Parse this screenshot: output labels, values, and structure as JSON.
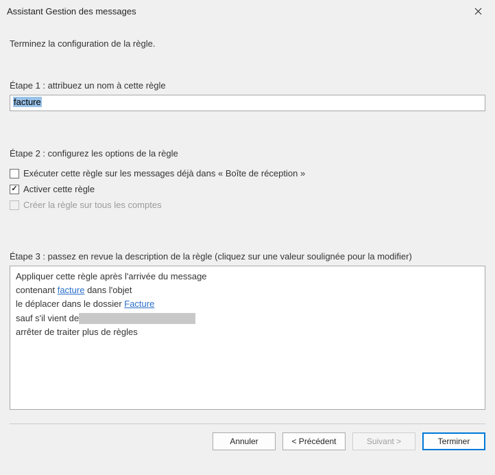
{
  "titlebar": {
    "title": "Assistant Gestion des messages",
    "close_label": "✕"
  },
  "intro": "Terminez la configuration de la règle.",
  "step1": {
    "label": "Étape 1 : attribuez un nom à cette règle",
    "value": "facture"
  },
  "step2": {
    "label": "Étape 2 : configurez les options de la règle",
    "opt_run_now": "Exécuter cette règle sur les messages déjà dans « Boîte de réception »",
    "opt_activate": "Activer cette règle",
    "opt_all_accounts": "Créer la règle sur tous les comptes"
  },
  "step3": {
    "label": "Étape 3 : passez en revue la description de la règle (cliquez sur une valeur soulignée pour la modifier)",
    "line_apply": "Appliquer cette règle après l'arrivée du message",
    "line_containing_pre": "contenant ",
    "line_containing_link": "facture",
    "line_containing_post": " dans l'objet",
    "line_move_pre": "le déplacer dans le dossier ",
    "line_move_link": "Facture",
    "line_except_pre": "sauf s'il vient de",
    "line_stop": "arrêter de traiter plus de règles"
  },
  "buttons": {
    "cancel": "Annuler",
    "prev": "<  Précédent",
    "next": "Suivant  >",
    "finish": "Terminer"
  }
}
